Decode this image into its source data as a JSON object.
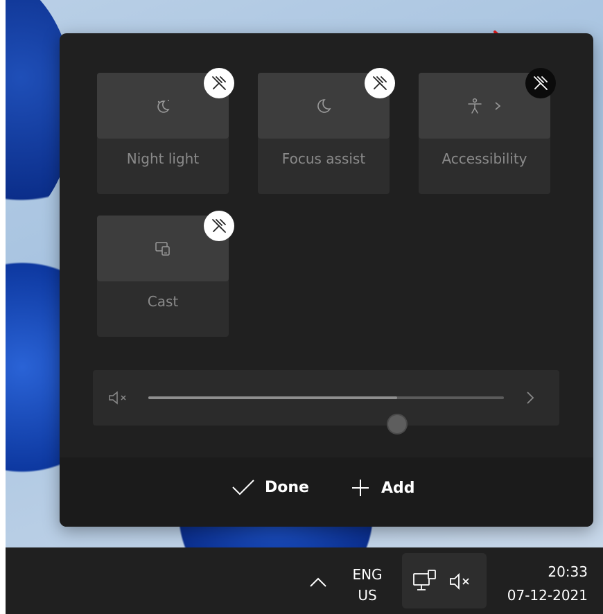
{
  "quick_settings": {
    "tiles": [
      {
        "label": "Night light",
        "icon": "night-light-icon",
        "unpin_icon": "unpin-icon"
      },
      {
        "label": "Focus assist",
        "icon": "moon-icon",
        "unpin_icon": "unpin-icon"
      },
      {
        "label": "Accessibility",
        "icon": "accessibility-icon",
        "unpin_icon": "unpin-icon",
        "has_chevron": true
      },
      {
        "label": "Cast",
        "icon": "cast-icon",
        "unpin_icon": "unpin-icon"
      }
    ],
    "volume": {
      "muted": true,
      "level_fraction": 0.7,
      "icon": "speaker-muted-icon",
      "more_icon": "chevron-right-icon"
    },
    "footer": {
      "done_label": "Done",
      "add_label": "Add"
    }
  },
  "taskbar": {
    "language_line1": "ENG",
    "language_line2": "US",
    "time": "20:33",
    "date": "07-12-2021",
    "icons": [
      "chevron-up-icon",
      "network-icon",
      "speaker-muted-icon"
    ]
  },
  "colors": {
    "panel_bg": "#202020",
    "tile_bg": "#2d2d2d",
    "annotation_arrow": "#e31b1b"
  }
}
